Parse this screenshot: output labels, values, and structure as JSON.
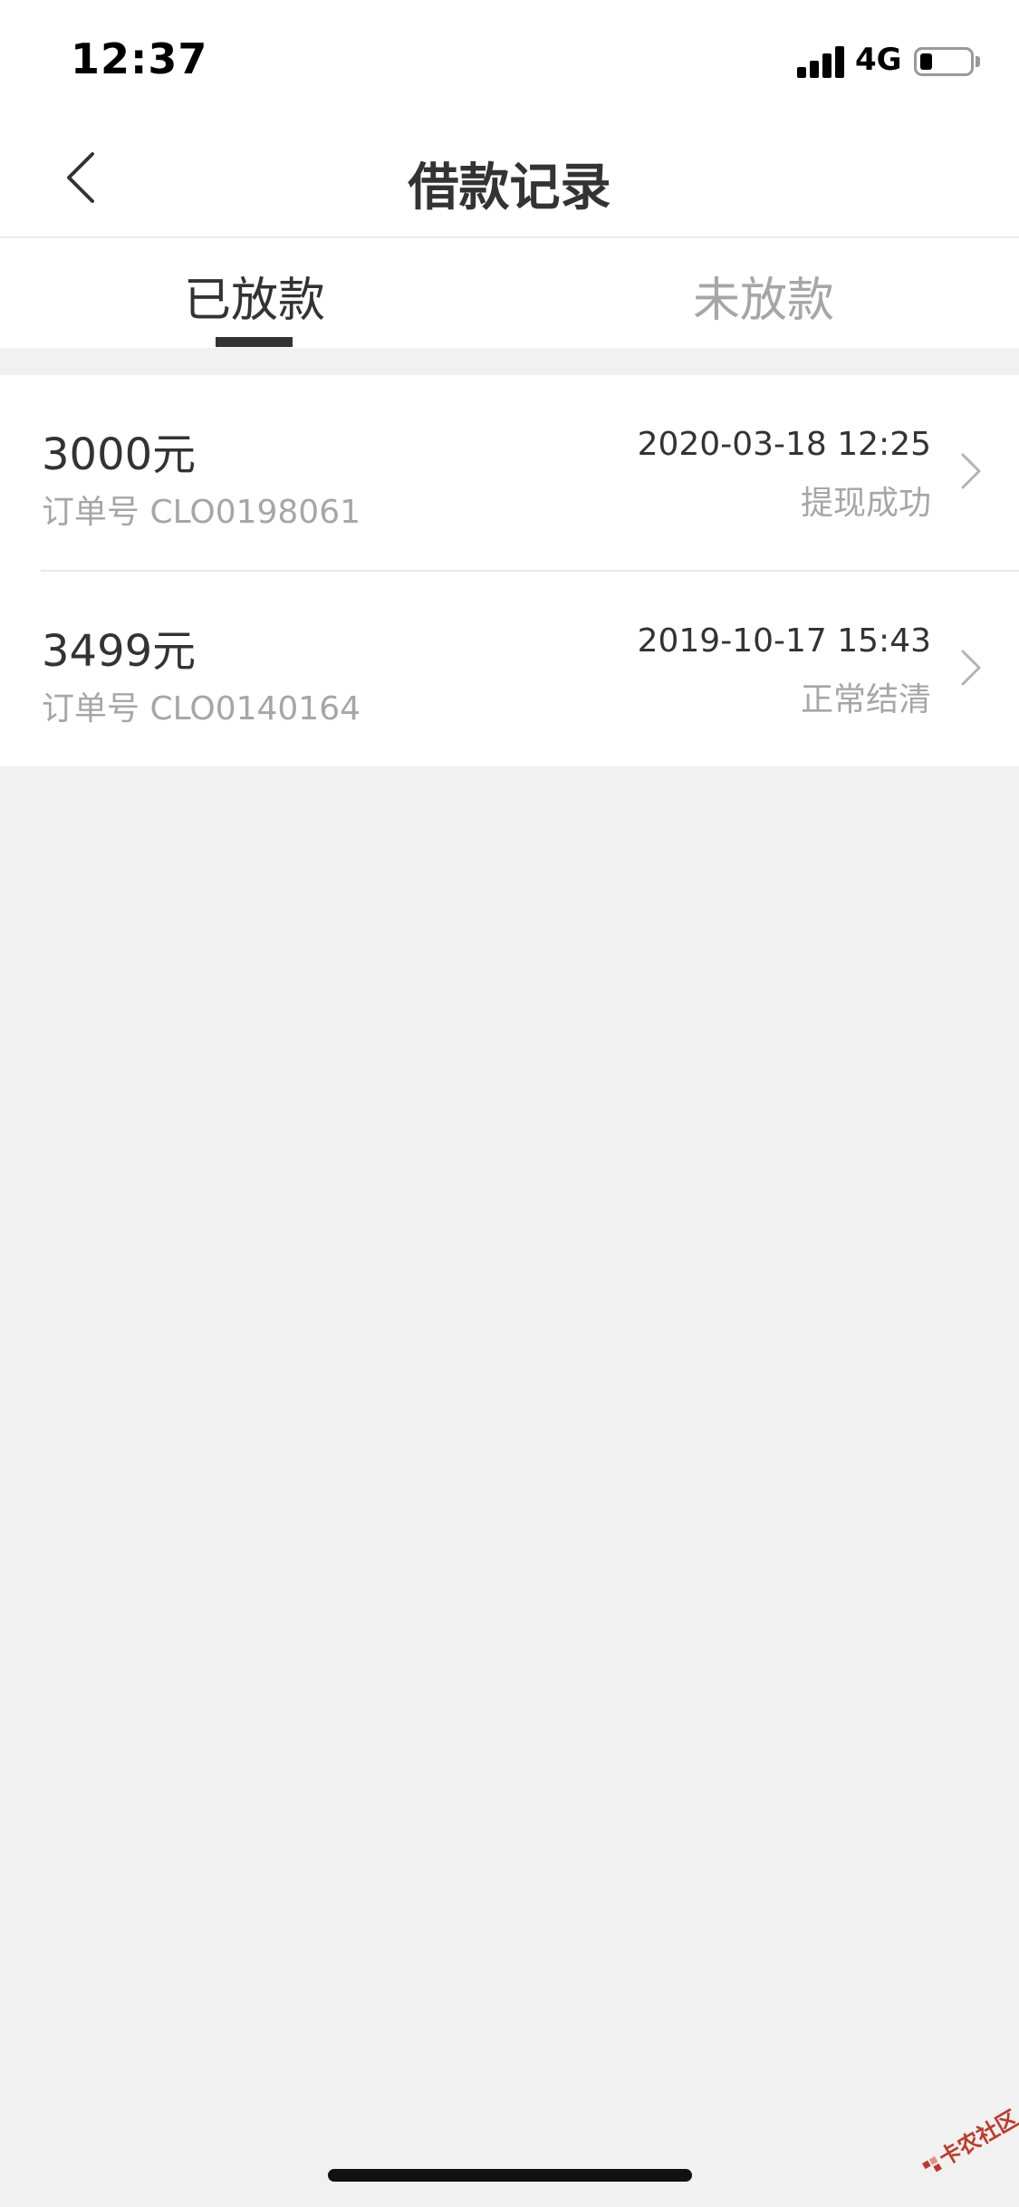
{
  "status_bar": {
    "time": "12:37",
    "network": "4G",
    "battery_level": 0.25
  },
  "nav": {
    "title": "借款记录",
    "back_icon": "chevron-left-icon"
  },
  "tabs": [
    {
      "label": "已放款",
      "active": true
    },
    {
      "label": "未放款",
      "active": false
    }
  ],
  "records": [
    {
      "amount": "3000元",
      "order_no": "订单号 CLO0198061",
      "datetime": "2020-03-18 12:25",
      "status": "提现成功"
    },
    {
      "amount": "3499元",
      "order_no": "订单号 CLO0140164",
      "datetime": "2019-10-17 15:43",
      "status": "正常结清"
    }
  ],
  "watermark": {
    "text": "卡农社区"
  },
  "colors": {
    "background": "#f1f1f1",
    "primary_text": "#333333",
    "secondary_text": "#a6a6a6",
    "watermark": "#c0392b"
  }
}
